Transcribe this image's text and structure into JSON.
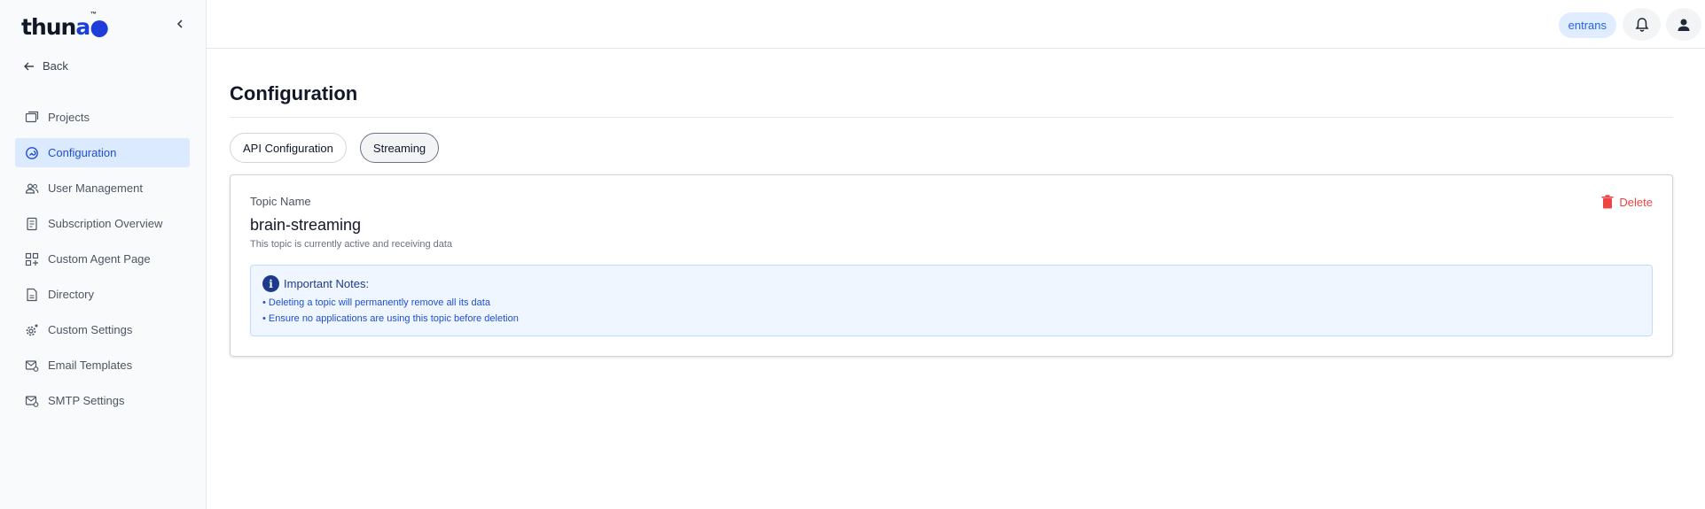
{
  "brand": {
    "logo_main": "thun",
    "logo_accent": "a",
    "logo_tm": "™"
  },
  "sidebar": {
    "back_label": "Back",
    "items": [
      {
        "label": "Projects",
        "icon": "folder-icon"
      },
      {
        "label": "Configuration",
        "icon": "configuration-icon",
        "active": true
      },
      {
        "label": "User Management",
        "icon": "users-icon"
      },
      {
        "label": "Subscription Overview",
        "icon": "receipt-icon"
      },
      {
        "label": "Custom Agent Page",
        "icon": "grid-add-icon"
      },
      {
        "label": "Directory",
        "icon": "document-icon"
      },
      {
        "label": "Custom Settings",
        "icon": "gear-icon"
      },
      {
        "label": "Email Templates",
        "icon": "mail-settings-icon"
      },
      {
        "label": "SMTP Settings",
        "icon": "mail-settings-icon"
      }
    ]
  },
  "header": {
    "user_badge": "entrans"
  },
  "main": {
    "title": "Configuration",
    "tabs": [
      {
        "label": "API Configuration",
        "active": false
      },
      {
        "label": "Streaming",
        "active": true
      }
    ],
    "topic": {
      "label": "Topic Name",
      "name": "brain-streaming",
      "status": "This topic is currently active and receiving data",
      "delete_label": "Delete"
    },
    "notes": {
      "icon_glyph": "i",
      "title": "Important Notes:",
      "lines": [
        "• Deleting a topic will permanently remove all its data",
        "• Ensure no applications are using this topic before deletion"
      ]
    }
  },
  "colors": {
    "accent": "#1d4ed8",
    "active_nav_bg": "#dbeafe",
    "danger": "#ef4444",
    "notes_bg": "#eff6ff"
  }
}
